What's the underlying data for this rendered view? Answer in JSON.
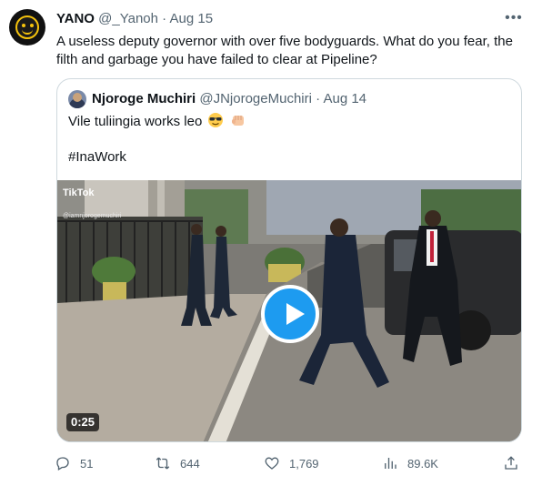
{
  "tweet": {
    "author_name": "YANO",
    "author_handle": "@_Yanoh",
    "separator": "·",
    "date": "Aug 15",
    "text": "A useless deputy governor with over five bodyguards. What do you fear, the filth and garbage you have failed to clear at Pipeline?"
  },
  "quoted": {
    "author_name": "Njoroge Muchiri",
    "author_handle": "@JNjorogeMuchiri",
    "separator": "·",
    "date": "Aug 14",
    "text": "Vile tuliingia works leo",
    "hashtag": "#InaWork",
    "video": {
      "duration": "0:25",
      "watermark": "TikTok",
      "watermark_sub": "@iamnjorogemuchiri"
    }
  },
  "actions": {
    "replies": "51",
    "reposts": "644",
    "likes": "1,769",
    "views": "89.6K"
  },
  "colors": {
    "accent": "#1d9bf0",
    "text": "#0f1419",
    "secondary": "#536471",
    "border": "#cfd9de"
  },
  "icons": [
    "more-icon",
    "reply-icon",
    "repost-icon",
    "like-icon",
    "views-icon",
    "share-icon",
    "play-icon"
  ]
}
